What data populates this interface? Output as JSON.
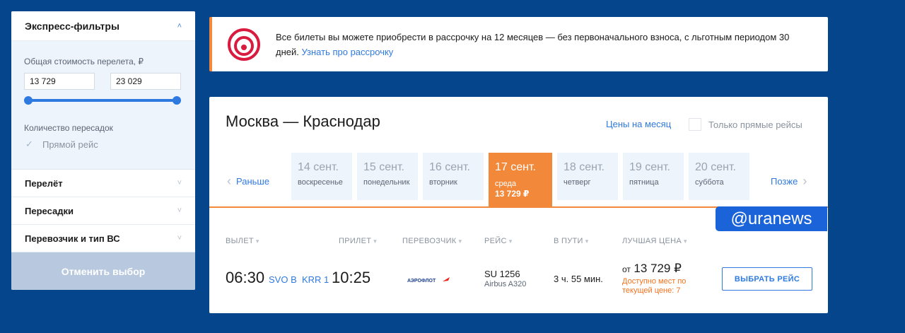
{
  "sidebar": {
    "express_title": "Экспресс-фильтры",
    "price_label": "Общая стоимость перелета, ₽",
    "price_min": "13 729",
    "price_max": "23 029",
    "transfers_label": "Количество пересадок",
    "direct_label": "Прямой рейс",
    "sections": [
      "Перелёт",
      "Пересадки",
      "Перевозчик и тип ВС"
    ],
    "cancel_label": "Отменить выбор"
  },
  "banner": {
    "text": "Все билеты вы можете приобрести в рассрочку на 12 месяцев — без первоначального взноса, с льготным периодом 30 дней.",
    "link": "Узнать про рассрочку"
  },
  "route": {
    "title": "Москва — Краснодар",
    "month_prices": "Цены на месяц",
    "direct_only": "Только прямые рейсы"
  },
  "dates": {
    "earlier": "Раньше",
    "later": "Позже",
    "days": [
      {
        "day": "14 сент.",
        "weekday": "воскресенье"
      },
      {
        "day": "15 сент.",
        "weekday": "понедельник"
      },
      {
        "day": "16 сент.",
        "weekday": "вторник"
      },
      {
        "day": "17 сент.",
        "weekday": "среда",
        "price": "13 729 ₽",
        "active": true
      },
      {
        "day": "18 сент.",
        "weekday": "четверг"
      },
      {
        "day": "19 сент.",
        "weekday": "пятница"
      },
      {
        "day": "20 сент.",
        "weekday": "суббота"
      }
    ]
  },
  "columns": [
    "ВЫЛЕТ",
    "ПРИЛЕТ",
    "ПЕРЕВОЗЧИК",
    "РЕЙС",
    "В ПУТИ",
    "ЛУЧШАЯ ЦЕНА"
  ],
  "flight": {
    "dep_time": "06:30",
    "dep_airport": "SVO B",
    "arr_airport": "KRR 1",
    "arr_time": "10:25",
    "carrier": "АЭРОФЛОТ",
    "flight_no": "SU 1256",
    "aircraft": "Airbus A320",
    "duration": "3 ч. 55 мин.",
    "price_prefix": "от",
    "price": "13 729 ₽",
    "availability": "Доступно мест по текущей цене: 7",
    "choose_label": "ВЫБРАТЬ РЕЙС"
  },
  "watermark": "@uranews",
  "colors": {
    "background": "#04458c",
    "accent_orange": "#f2893a",
    "link_blue": "#2f7ae0"
  }
}
